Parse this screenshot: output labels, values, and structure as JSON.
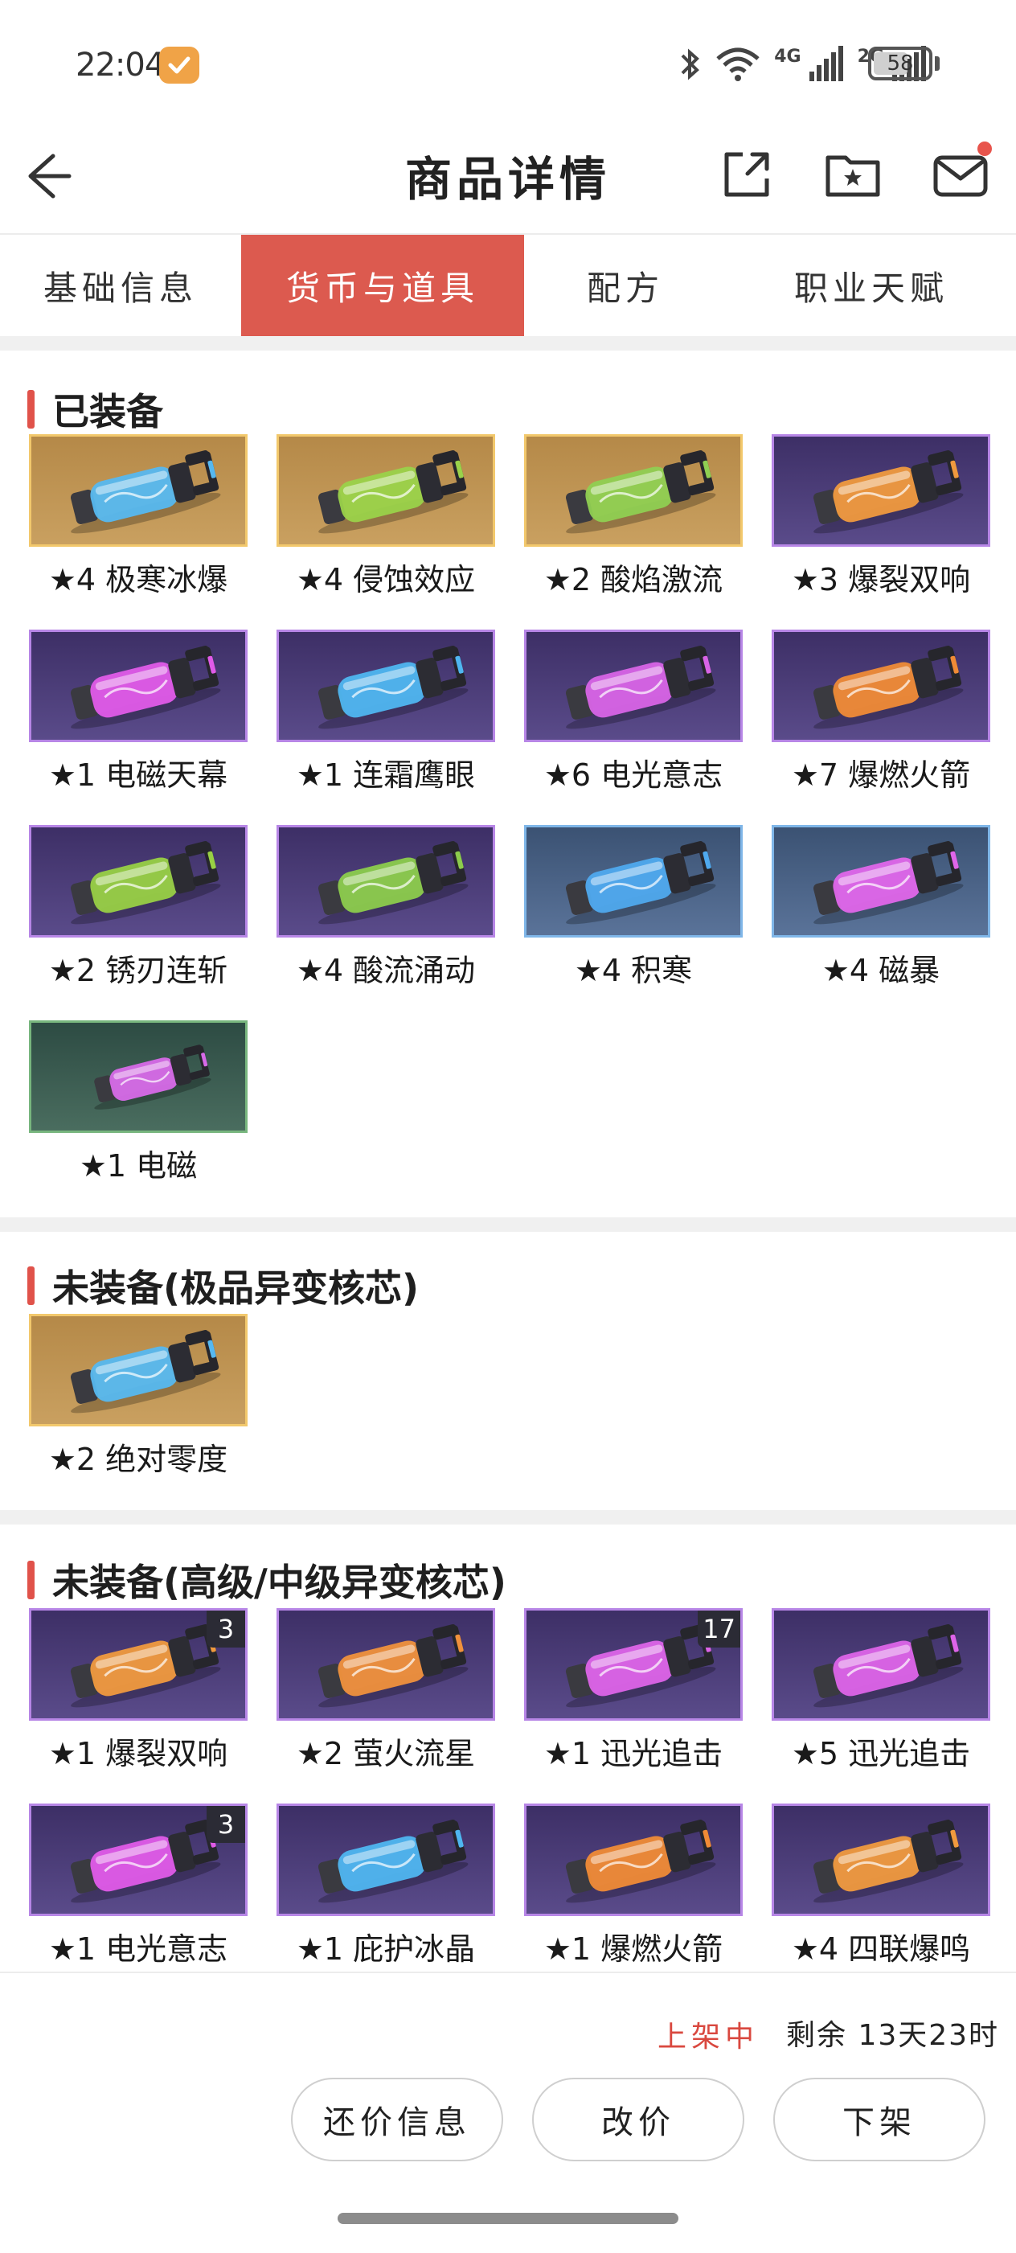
{
  "status_bar": {
    "time": "22:04",
    "signal_1": "4G",
    "signal_2": "2G",
    "battery": "58"
  },
  "header": {
    "title": "商品详情"
  },
  "tabs": [
    {
      "label": "基础信息",
      "active": false
    },
    {
      "label": "货币与道具",
      "active": true
    },
    {
      "label": "配方",
      "active": false
    },
    {
      "label": "职业天赋",
      "active": false
    }
  ],
  "sections": {
    "equipped": {
      "title": "已装备",
      "items": [
        {
          "name": "★4 极寒冰爆",
          "frame": "gold",
          "liquid": "#56b8f0",
          "count": ""
        },
        {
          "name": "★4 侵蚀效应",
          "frame": "gold",
          "liquid": "#9ad24a",
          "count": ""
        },
        {
          "name": "★2 酸焰激流",
          "frame": "gold",
          "liquid": "#8fcf52",
          "count": ""
        },
        {
          "name": "★3 爆裂双响",
          "frame": "purple",
          "liquid": "#f09a3e",
          "count": ""
        },
        {
          "name": "★1 电磁天幕",
          "frame": "purple",
          "liquid": "#e05be8",
          "count": ""
        },
        {
          "name": "★1 连霜鹰眼",
          "frame": "purple",
          "liquid": "#4fb6f0",
          "count": ""
        },
        {
          "name": "★6 电光意志",
          "frame": "purple",
          "liquid": "#d864e6",
          "count": ""
        },
        {
          "name": "★7 爆燃火箭",
          "frame": "purple",
          "liquid": "#f08b36",
          "count": ""
        },
        {
          "name": "★2 锈刃连斩",
          "frame": "purple",
          "liquid": "#98d044",
          "count": ""
        },
        {
          "name": "★4 酸流涌动",
          "frame": "purple",
          "liquid": "#8ccc4c",
          "count": ""
        },
        {
          "name": "★4 积寒",
          "frame": "blue",
          "liquid": "#4fa9ee",
          "count": ""
        },
        {
          "name": "★4 磁暴",
          "frame": "blue",
          "liquid": "#e066ea",
          "count": ""
        },
        {
          "name": "★1 电磁",
          "frame": "green",
          "liquid": "#d76ae8",
          "count": ""
        }
      ]
    },
    "unequipped_top": {
      "title": "未装备(极品异变核芯)",
      "items": [
        {
          "name": "★2 绝对零度",
          "frame": "gold",
          "liquid": "#56b8f0",
          "count": ""
        }
      ]
    },
    "unequipped_high": {
      "title": "未装备(高级/中级异变核芯)",
      "items": [
        {
          "name": "★1 爆裂双响",
          "frame": "purple",
          "liquid": "#f09a3e",
          "count": "3"
        },
        {
          "name": "★2 萤火流星",
          "frame": "purple",
          "liquid": "#f0913c",
          "count": ""
        },
        {
          "name": "★1 迅光追击",
          "frame": "purple",
          "liquid": "#dd64e8",
          "count": "17"
        },
        {
          "name": "★5 迅光追击",
          "frame": "purple",
          "liquid": "#dd64e8",
          "count": ""
        },
        {
          "name": "★1 电光意志",
          "frame": "purple",
          "liquid": "#e05be8",
          "count": "3"
        },
        {
          "name": "★1 庇护冰晶",
          "frame": "purple",
          "liquid": "#4fb6f0",
          "count": ""
        },
        {
          "name": "★1 爆燃火箭",
          "frame": "purple",
          "liquid": "#f08b36",
          "count": ""
        },
        {
          "name": "★4 四联爆鸣",
          "frame": "purple",
          "liquid": "#f09a3e",
          "count": ""
        }
      ]
    }
  },
  "footer": {
    "status": "上架中",
    "remaining": "剩余 13天23时",
    "buttons": {
      "counter_offer": "还价信息",
      "edit_price": "改价",
      "delist": "下架"
    }
  },
  "colors": {
    "accent": "#dc5a4f",
    "section_bar": "#e0524a",
    "status_red": "#d9483f"
  }
}
